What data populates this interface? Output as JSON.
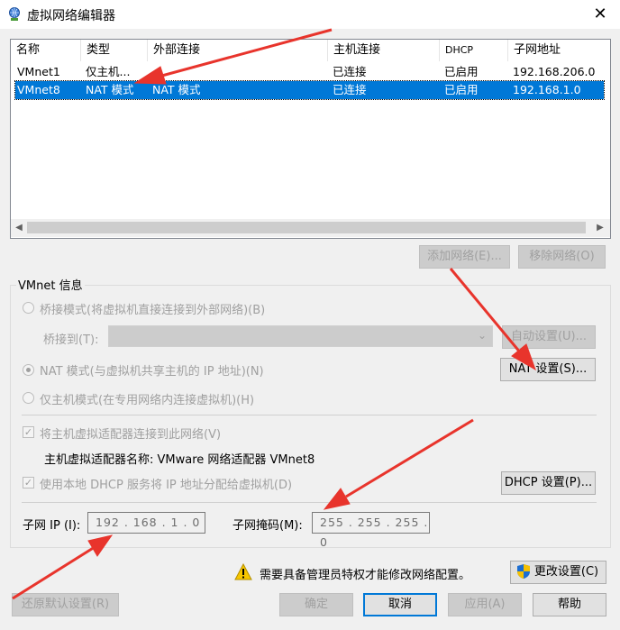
{
  "window": {
    "title": "虚拟网络编辑器",
    "close_glyph": "✕"
  },
  "netlist": {
    "columns": [
      "名称",
      "类型",
      "外部连接",
      "主机连接",
      "DHCP",
      "子网地址"
    ],
    "rows": [
      [
        "VMnet1",
        "仅主机...",
        "-",
        "已连接",
        "已启用",
        "192.168.206.0"
      ],
      [
        "VMnet8",
        "NAT 模式",
        "NAT 模式",
        "已连接",
        "已启用",
        "192.168.1.0"
      ]
    ],
    "selected_row": 1
  },
  "list_buttons": {
    "add": "添加网络(E)...",
    "remove": "移除网络(O)"
  },
  "vmnet_info": {
    "title": "VMnet 信息",
    "bridged_label": "桥接模式(将虚拟机直接连接到外部网络)(B)",
    "bridged_to_label": "桥接到(T):",
    "auto_settings": "自动设置(U)...",
    "nat_label": "NAT 模式(与虚拟机共享主机的 IP 地址)(N)",
    "nat_settings": "NAT 设置(S)...",
    "hostonly_label": "仅主机模式(在专用网络内连接虚拟机)(H)",
    "connect_adapter_label": "将主机虚拟适配器连接到此网络(V)",
    "adapter_name_label": "主机虚拟适配器名称: VMware 网络适配器 VMnet8",
    "dhcp_label": "使用本地 DHCP 服务将 IP 地址分配给虚拟机(D)",
    "dhcp_settings": "DHCP 设置(P)...",
    "subnet_ip_label": "子网 IP (I):",
    "subnet_ip_value": "192 . 168 .  1  .  0",
    "subnet_mask_label": "子网掩码(M):",
    "subnet_mask_value": "255 . 255 . 255 .  0"
  },
  "admin": {
    "message": "需要具备管理员特权才能修改网络配置。",
    "change_settings": "更改设置(C)"
  },
  "footer": {
    "restore_defaults": "还原默认设置(R)",
    "ok": "确定",
    "cancel": "取消",
    "apply": "应用(A)",
    "help": "帮助"
  },
  "colors": {
    "selection": "#0078d7",
    "annotation_arrow": "#e8342c",
    "disabled_text": "#a0a0a0"
  },
  "icons": [
    "network-globe-icon",
    "close-icon",
    "chevron-down-icon",
    "warning-icon",
    "uac-shield-icon"
  ]
}
